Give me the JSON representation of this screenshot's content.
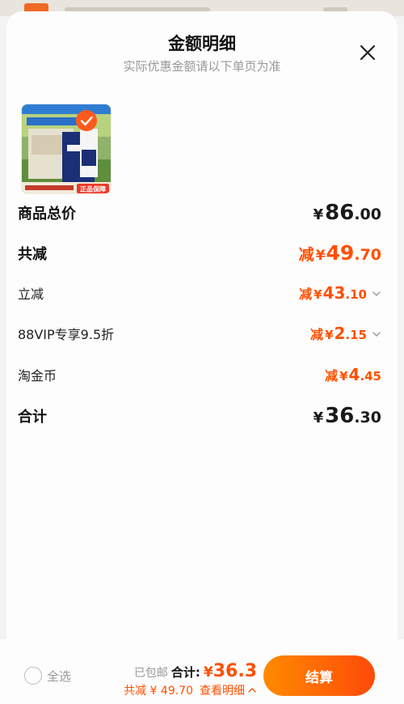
{
  "header": {
    "title": "金额明细",
    "subtitle": "实际优惠金额请以下单页为准"
  },
  "product": {
    "tag_text": "正品保障"
  },
  "rows": {
    "total": {
      "label": "商品总价",
      "yen": "¥",
      "int": "86",
      "dec": ".00"
    },
    "discount": {
      "label": "共减",
      "jian": "减",
      "yen": "¥",
      "int": "49",
      "dec": ".70"
    },
    "instant": {
      "label": "立减",
      "jian": "减",
      "yen": "¥",
      "int": "43",
      "dec": ".10"
    },
    "vip": {
      "label": "88VIP专享9.5折",
      "jian": "减",
      "yen": "¥",
      "int": "2",
      "dec": ".15"
    },
    "coin": {
      "label": "淘金币",
      "jian": "减",
      "yen": "¥",
      "int": "4",
      "dec": ".45"
    },
    "sum": {
      "label": "合计",
      "yen": "¥",
      "int": "36",
      "dec": ".30"
    }
  },
  "footer": {
    "select_all": "全选",
    "free_shipping": "已包邮",
    "total_label": "合计:",
    "yen": "¥",
    "amount": "36.3",
    "discount_text": "共减 ¥ 49.70",
    "details_link": "查看明细",
    "checkout": "结算"
  },
  "colors": {
    "accent": "#ff5000",
    "button_start": "#ff8a00",
    "button_end": "#ff4a0a"
  },
  "icons": [
    "close-icon",
    "check-icon",
    "chevron-down-icon",
    "chevron-up-icon"
  ]
}
